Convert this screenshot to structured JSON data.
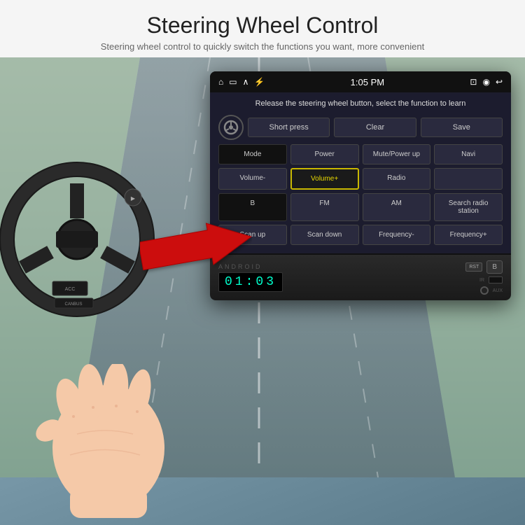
{
  "header": {
    "title": "Steering Wheel Control",
    "subtitle": "Steering wheel control to quickly switch the functions you want, more convenient"
  },
  "screen": {
    "status_bar": {
      "time": "1:05 PM",
      "left_icons": [
        "home",
        "screen",
        "up",
        "usb"
      ],
      "right_icons": [
        "cast",
        "location",
        "back"
      ]
    },
    "instruction": "Release the steering wheel button, select the function to learn",
    "top_buttons": {
      "short_press": "Short press",
      "clear": "Clear",
      "save": "Save"
    },
    "grid_buttons": [
      "Mode",
      "Power",
      "Mute/Power up",
      "Navi",
      "Volume-",
      "Volume+",
      "Radio",
      "",
      "B",
      "FM",
      "AM",
      "Search radio station",
      "Scan up",
      "Scan down",
      "Frequency-",
      "Frequency+"
    ]
  },
  "player": {
    "brand": "ANDROID",
    "led_time": "01:03",
    "rst_label": "RST",
    "b_label": "B",
    "ir_label": "IR",
    "aux_label": "AUX"
  }
}
